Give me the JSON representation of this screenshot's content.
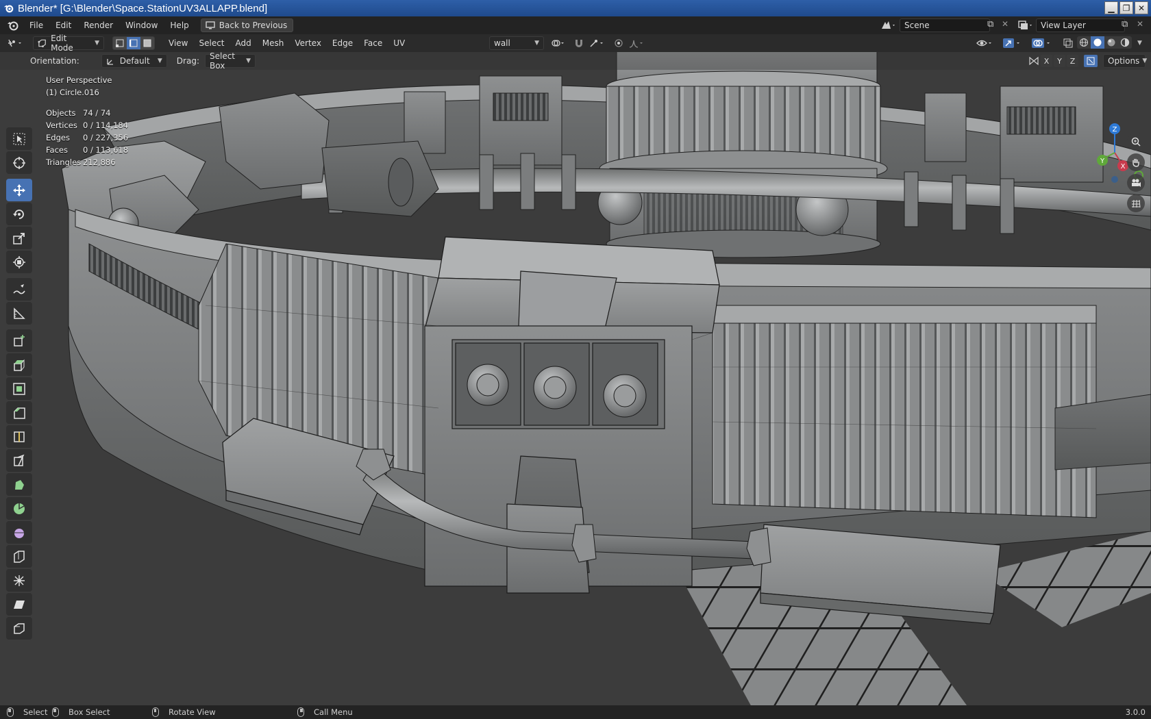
{
  "window": {
    "title": "Blender* [G:\\Blender\\Space.StationUV3ALLAPP.blend]",
    "minimize": "▁",
    "maximize": "❐",
    "close": "✕"
  },
  "menubar": {
    "items": [
      "File",
      "Edit",
      "Render",
      "Window",
      "Help"
    ],
    "back_button": "Back to Previous",
    "scene_label": "Scene",
    "view_layer_label": "View Layer"
  },
  "header": {
    "mode": "Edit Mode",
    "select_modes": [
      "vertex",
      "edge",
      "face"
    ],
    "active_select_mode": "edge",
    "menus": [
      "View",
      "Select",
      "Add",
      "Mesh",
      "Vertex",
      "Edge",
      "Face",
      "UV"
    ],
    "uv_map": "wall",
    "options_label": "Options"
  },
  "tool_settings": {
    "orientation_label": "Orientation:",
    "orientation_value": "Default",
    "drag_label": "Drag:",
    "drag_value": "Select Box"
  },
  "viewport": {
    "perspective": "User Perspective",
    "object": "(1) Circle.016",
    "stats": [
      {
        "key": "Objects",
        "value": "74 / 74"
      },
      {
        "key": "Vertices",
        "value": "0 / 114,184"
      },
      {
        "key": "Edges",
        "value": "0 / 227,356"
      },
      {
        "key": "Faces",
        "value": "0 / 113,618"
      },
      {
        "key": "Triangles",
        "value": "212,886"
      }
    ],
    "axis_buttons": [
      "X",
      "Y",
      "Z"
    ],
    "gizmo_axes": {
      "x": "X",
      "y": "Y",
      "z": "Z"
    }
  },
  "toolbar": {
    "tools": [
      "select-box",
      "cursor",
      "move",
      "rotate",
      "scale",
      "transform",
      "annotate",
      "measure",
      "add-cube",
      "extrude-region",
      "inset-faces",
      "bevel",
      "loop-cut",
      "knife",
      "poly-build",
      "spin",
      "smooth",
      "edge-slide",
      "shrink-fatten",
      "shear",
      "rip-region"
    ],
    "active": "move"
  },
  "statusbar": {
    "select": "Select",
    "box_select": "Box Select",
    "rotate_view": "Rotate View",
    "call_menu": "Call Menu",
    "version": "3.0.0"
  },
  "colors": {
    "accent": "#4772b3",
    "viewport_bg": "#3d3d3d",
    "mesh": "#8d8f90",
    "wire": "#1c1c1c"
  }
}
